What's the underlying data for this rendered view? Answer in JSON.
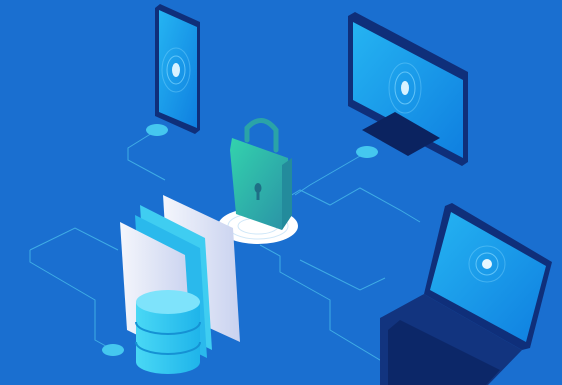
{
  "scene": {
    "background": "#1a6fd0",
    "devices": [
      "smartphone",
      "desktop-monitor",
      "laptop"
    ],
    "central_element": "padlock",
    "storage": [
      "document-stack",
      "database-cylinder"
    ]
  },
  "colors": {
    "device_dark": "#0f2f7a",
    "device_edge": "#0a2460",
    "screen": "#1289e6",
    "screen_light": "#25a9f0",
    "lock_green": "#2ec7a8",
    "lock_teal": "#2aa3a8",
    "db_cyan": "#36c9f0",
    "paper": "#e8ecf7",
    "connector": "#5fd3f0"
  }
}
